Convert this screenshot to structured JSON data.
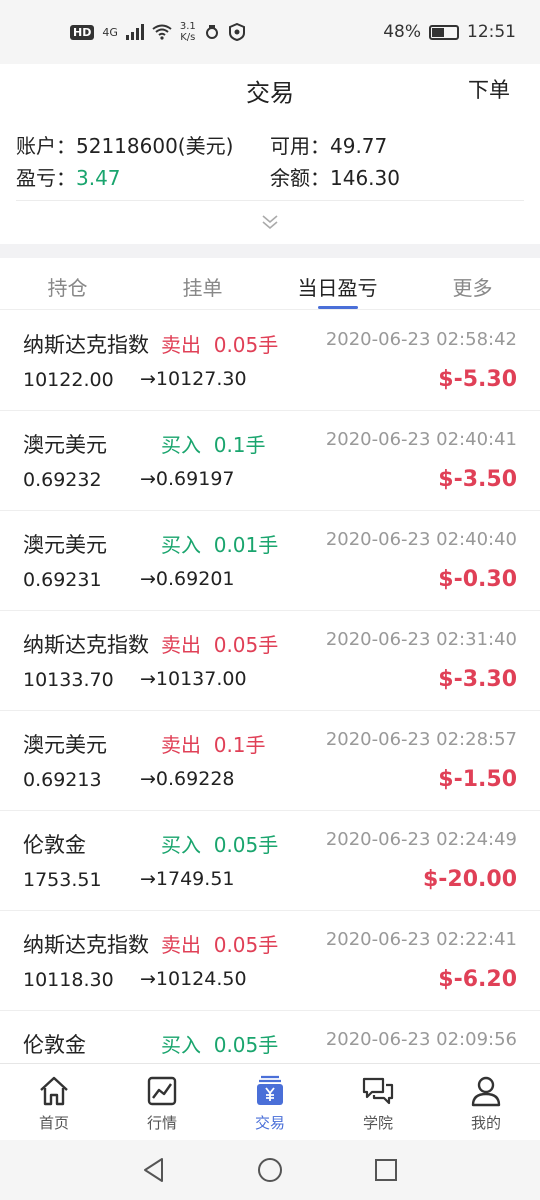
{
  "status_bar": {
    "hd": "HD",
    "net_type": "4G",
    "speed_value": "3.1",
    "speed_unit": "K/s",
    "battery": "48%",
    "time": "12:51"
  },
  "header": {
    "title": "交易",
    "order_label": "下单"
  },
  "account": {
    "account_label": "账户：",
    "account_value": "52118600(美元)",
    "available_label": "可用：",
    "available_value": "49.77",
    "pnl_label": "盈亏：",
    "pnl_value": "3.47",
    "balance_label": "余额：",
    "balance_value": "146.30"
  },
  "tabs": [
    {
      "label": "持仓"
    },
    {
      "label": "挂单"
    },
    {
      "label": "当日盈亏"
    },
    {
      "label": "更多"
    }
  ],
  "trades": [
    {
      "name": "纳斯达克指数",
      "direction": "卖出",
      "lots": "0.05手",
      "time": "2020-06-23 02:58:42",
      "open": "10122.00",
      "close": "→10127.30",
      "pnl": "$-5.30"
    },
    {
      "name": "澳元美元",
      "direction": "买入",
      "lots": "0.1手",
      "time": "2020-06-23 02:40:41",
      "open": "0.69232",
      "close": "→0.69197",
      "pnl": "$-3.50"
    },
    {
      "name": "澳元美元",
      "direction": "买入",
      "lots": "0.01手",
      "time": "2020-06-23 02:40:40",
      "open": "0.69231",
      "close": "→0.69201",
      "pnl": "$-0.30"
    },
    {
      "name": "纳斯达克指数",
      "direction": "卖出",
      "lots": "0.05手",
      "time": "2020-06-23 02:31:40",
      "open": "10133.70",
      "close": "→10137.00",
      "pnl": "$-3.30"
    },
    {
      "name": "澳元美元",
      "direction": "卖出",
      "lots": "0.1手",
      "time": "2020-06-23 02:28:57",
      "open": "0.69213",
      "close": "→0.69228",
      "pnl": "$-1.50"
    },
    {
      "name": "伦敦金",
      "direction": "买入",
      "lots": "0.05手",
      "time": "2020-06-23 02:24:49",
      "open": "1753.51",
      "close": "→1749.51",
      "pnl": "$-20.00"
    },
    {
      "name": "纳斯达克指数",
      "direction": "卖出",
      "lots": "0.05手",
      "time": "2020-06-23 02:22:41",
      "open": "10118.30",
      "close": "→10124.50",
      "pnl": "$-6.20"
    },
    {
      "name": "伦敦金",
      "direction": "买入",
      "lots": "0.05手",
      "time": "2020-06-23 02:09:56",
      "open": "",
      "close": "",
      "pnl": ""
    }
  ],
  "bottom_nav": [
    {
      "label": "首页",
      "icon": "home-icon"
    },
    {
      "label": "行情",
      "icon": "chart-icon"
    },
    {
      "label": "交易",
      "icon": "yen-wallet-icon"
    },
    {
      "label": "学院",
      "icon": "chat-icon"
    },
    {
      "label": "我的",
      "icon": "user-icon"
    }
  ],
  "colors": {
    "buy": "#1aa56e",
    "sell": "#e04057",
    "accent": "#4a6fd8",
    "loss": "#e04057"
  }
}
